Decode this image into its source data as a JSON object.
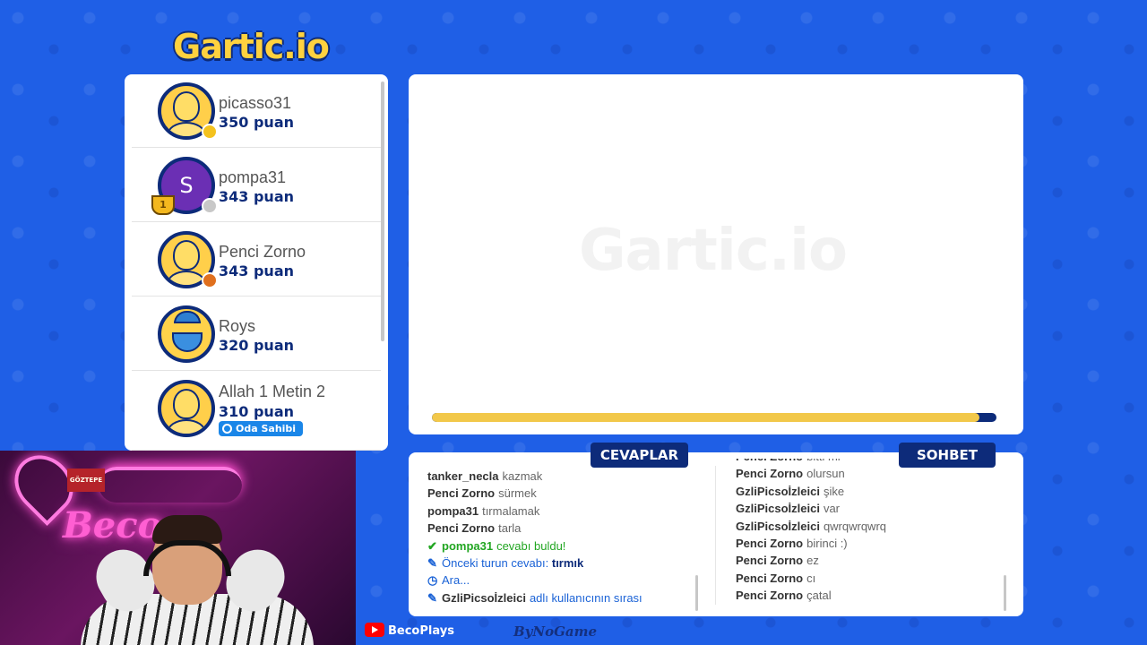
{
  "app": {
    "logo_text": "Gartic.io",
    "watermark": "Gartic.io"
  },
  "players": [
    {
      "name": "picasso31",
      "points": "350 puan",
      "avatar": "smiley-avatar",
      "status_color": "#f4c21e"
    },
    {
      "name": "pompa31",
      "points": "343 puan",
      "avatar": "letter-avatar",
      "avatar_letter": "S",
      "status_color": "#c8c8c8",
      "rank_badge": "1"
    },
    {
      "name": "Penci Zorno",
      "points": "343 puan",
      "avatar": "smiley-avatar",
      "status_color": "#e0701e"
    },
    {
      "name": "Roys",
      "points": "320 puan",
      "avatar": "bearded-avatar"
    },
    {
      "name": "Allah 1 Metin 2",
      "points": "310 puan",
      "avatar": "smiley-avatar",
      "badge": "Oda Sahibi"
    }
  ],
  "canvas": {
    "timer_progress": 0.97,
    "timer_color": "#f2c84a"
  },
  "tabs": {
    "answers": "CEVAPLAR",
    "chat": "SOHBET"
  },
  "answers": [
    {
      "user": "tanker_necla",
      "text": "kazmak"
    },
    {
      "user": "Penci Zorno",
      "text": "sürmek"
    },
    {
      "user": "pompa31",
      "text": "tırmalamak"
    },
    {
      "user": "Penci Zorno",
      "text": "tarla"
    },
    {
      "type": "correct",
      "icon": "check-icon",
      "user": "pompa31",
      "text": "cevabı buldu!"
    },
    {
      "type": "sys",
      "icon": "pencil-icon",
      "text": "Önceki turun cevabı:",
      "value": "tırmık"
    },
    {
      "type": "sys",
      "icon": "clock-icon",
      "text": "Ara..."
    },
    {
      "type": "sys",
      "icon": "pencil-icon",
      "user": "GzliPicsoİzleici",
      "text": "adlı kullanıcının sırası"
    }
  ],
  "chat": [
    {
      "user": "Penci Zorno",
      "text": "bitti mi"
    },
    {
      "user": "Penci Zorno",
      "text": "olursun"
    },
    {
      "user": "GzliPicsoİzleici",
      "text": "şike"
    },
    {
      "user": "GzliPicsoİzleici",
      "text": "var"
    },
    {
      "user": "GzliPicsoİzleici",
      "text": "qwrqwrqwrq"
    },
    {
      "user": "Penci Zorno",
      "text": "birinci :)"
    },
    {
      "user": "Penci Zorno",
      "text": "ez"
    },
    {
      "user": "Penci Zorno",
      "text": "cı"
    },
    {
      "user": "Penci Zorno",
      "text": "çatal"
    }
  ],
  "stream": {
    "webcam_sign": "GÖZTEPE",
    "neon_text": "Beco",
    "channel": "BecoPlays",
    "watermark": "ByNoGame"
  }
}
